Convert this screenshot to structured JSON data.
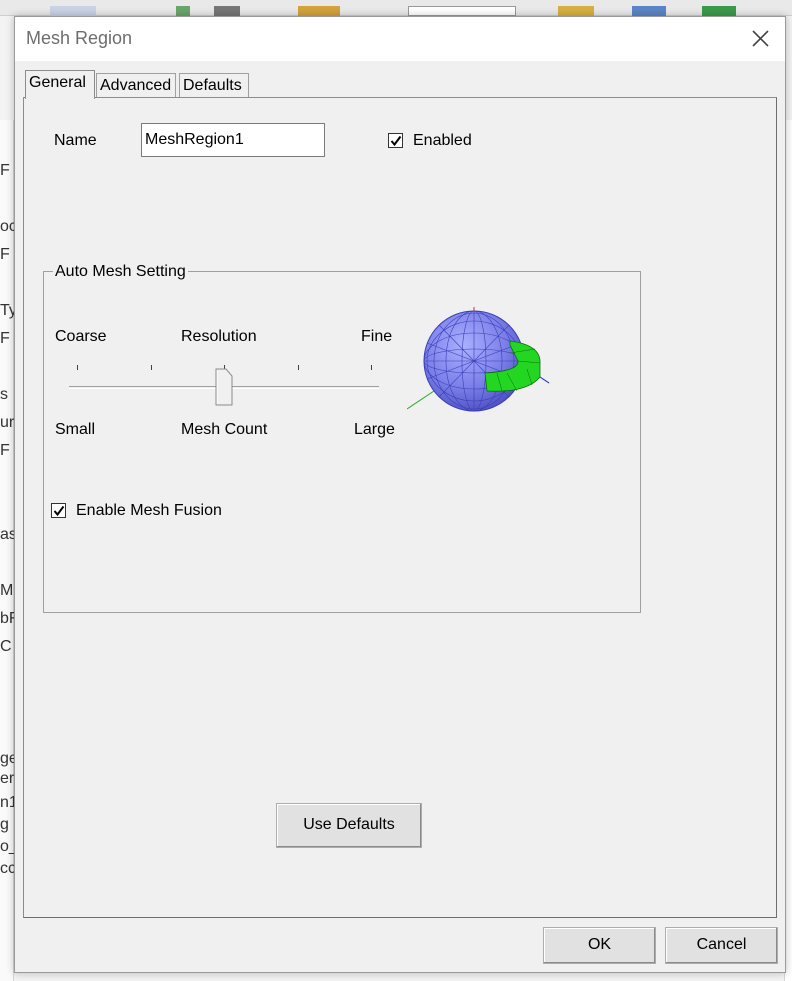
{
  "window": {
    "title": "Mesh Region"
  },
  "tabs": [
    {
      "label": "General",
      "active": true
    },
    {
      "label": "Advanced",
      "active": false
    },
    {
      "label": "Defaults",
      "active": false
    }
  ],
  "general": {
    "name_label": "Name",
    "name_value": "MeshRegion1",
    "enabled_label": "Enabled",
    "enabled_checked": true,
    "group_title": "Auto Mesh Setting",
    "slider": {
      "top_left": "Coarse",
      "top_center": "Resolution",
      "top_right": "Fine",
      "bottom_left": "Small",
      "bottom_center": "Mesh Count",
      "bottom_right": "Large",
      "tick_count": 5,
      "value_fraction": 0.5
    },
    "fusion_label": "Enable Mesh Fusion",
    "fusion_checked": true,
    "use_defaults_label": "Use Defaults"
  },
  "footer": {
    "ok_label": "OK",
    "cancel_label": "Cancel"
  },
  "background_fragments": [
    "F",
    "oc",
    "F",
    "Ty",
    "F",
    "s",
    "ur",
    "F",
    "as",
    "Mc",
    "bF",
    "C",
    "ge",
    "ers",
    "n1",
    "g -",
    "o_",
    "cc"
  ],
  "colors": {
    "sphere": "#7b7ee8",
    "sphere_edges": "#3a3fb8",
    "cap": "#22d622",
    "axis_x": "#1a1aff",
    "axis_y": "#ff2020",
    "axis_z": "#22aa22"
  },
  "icons": {
    "close": "close-icon",
    "check": "checkmark-icon",
    "mesh_preview": "mesh-sphere-preview-icon"
  }
}
